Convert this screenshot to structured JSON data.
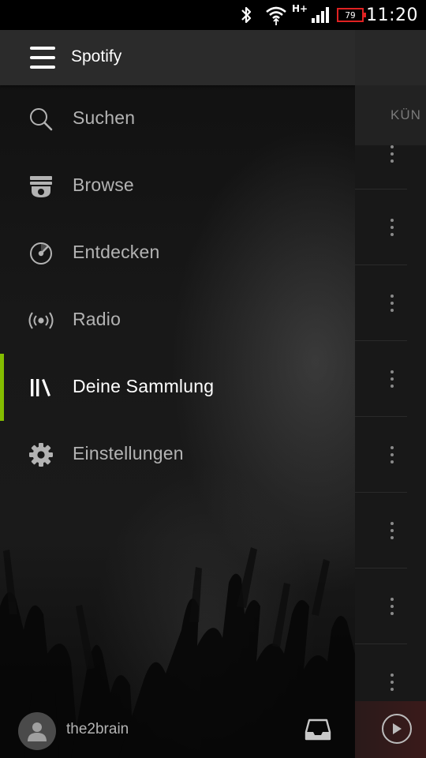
{
  "status_bar": {
    "network_type": "H+",
    "battery_level": "79",
    "time": "11:20"
  },
  "header": {
    "title": "Spotify"
  },
  "nav": {
    "items": [
      {
        "label": "Suchen",
        "icon": "search-icon",
        "active": false
      },
      {
        "label": "Browse",
        "icon": "browse-icon",
        "active": false
      },
      {
        "label": "Entdecken",
        "icon": "discover-icon",
        "active": false
      },
      {
        "label": "Radio",
        "icon": "radio-icon",
        "active": false
      },
      {
        "label": "Deine Sammlung",
        "icon": "library-icon",
        "active": true
      },
      {
        "label": "Einstellungen",
        "icon": "gear-icon",
        "active": false
      }
    ]
  },
  "footer": {
    "username": "the2brain"
  },
  "background_view": {
    "tab_label": "KÜN"
  },
  "colors": {
    "accent": "#84bd00",
    "drawer_header": "#2b2b2b",
    "text_primary": "#ffffff",
    "text_secondary": "#b3b3b3"
  }
}
